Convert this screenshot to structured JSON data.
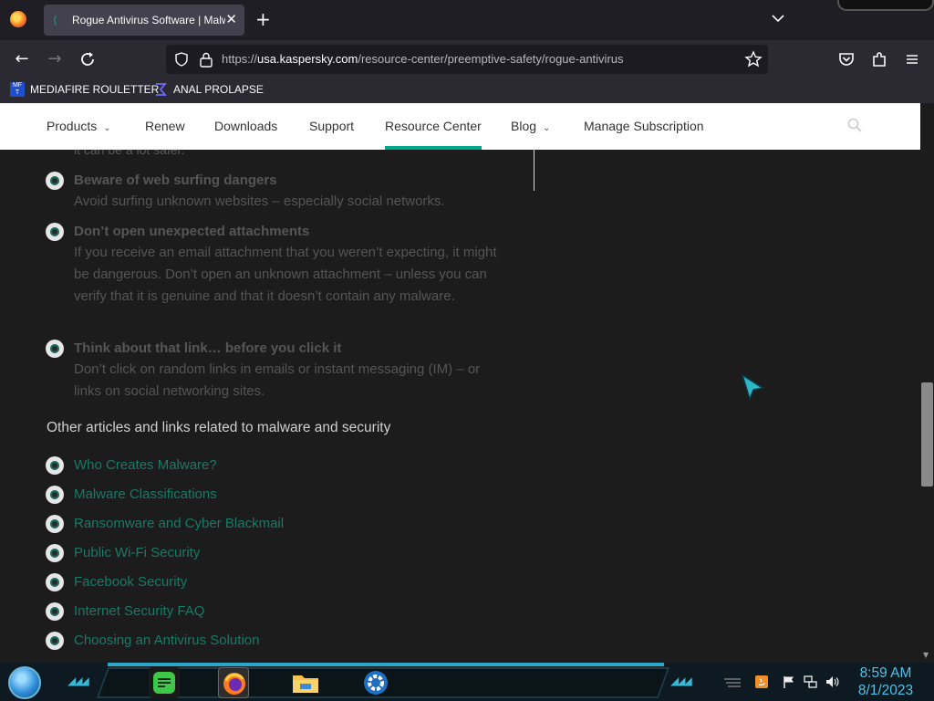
{
  "browser": {
    "tab_title": "Rogue Antivirus Software | Malware",
    "tab_close": "✕",
    "new_tab": "+",
    "url_host": "usa.kaspersky.com",
    "url_prefix": "https://",
    "url_path": "/resource-center/preemptive-safety/rogue-antivirus",
    "bookmarks": [
      {
        "label": "MEDIAFIRE ROULETTER",
        "icon": "mediafire-icon"
      },
      {
        "label": "ANAL PROLAPSE",
        "icon": "sigma-icon"
      }
    ]
  },
  "site_nav": {
    "items": [
      {
        "label": "Products",
        "has_dropdown": true
      },
      {
        "label": "Renew",
        "has_dropdown": false
      },
      {
        "label": "Downloads",
        "has_dropdown": false
      },
      {
        "label": "Support",
        "has_dropdown": false
      },
      {
        "label": "Resource Center",
        "has_dropdown": false,
        "active": true
      },
      {
        "label": "Blog",
        "has_dropdown": true
      },
      {
        "label": "Manage Subscription",
        "has_dropdown": false
      }
    ],
    "chevron": "⌄",
    "active_color": "#00a88e"
  },
  "content": {
    "faded_top": "it can be a lot safer.",
    "tips": [
      {
        "title": "Beware of web surfing dangers",
        "body": "Avoid surfing unknown websites – especially social networks."
      },
      {
        "title": "Don’t open unexpected attachments",
        "body": "If you receive an email attachment that you weren’t expecting, it might be dangerous. Don’t open an unknown attachment – unless you can verify that it is genuine and that it doesn’t contain any malware."
      },
      {
        "title": "Think about that link… before you click it",
        "body": "Don’t click on random links in emails or instant messaging (IM) – or links on social networking sites."
      }
    ],
    "related_heading": "Other articles and links related to malware and security",
    "links": [
      "Who Creates Malware?",
      "Malware Classifications",
      "Ransomware and Cyber Blackmail",
      "Public Wi-Fi Security",
      "Facebook Security",
      "Internet Security FAQ",
      "Choosing an Antivirus Solution"
    ],
    "link_color": "#187a68"
  },
  "taskbar": {
    "time": "8:59 AM",
    "date": "8/1/2023",
    "apps": [
      "notes-icon",
      "firefox-icon",
      "file-explorer-icon",
      "settings-icon"
    ],
    "tray": [
      "java-icon",
      "flag-icon",
      "network-icon",
      "volume-icon"
    ]
  }
}
